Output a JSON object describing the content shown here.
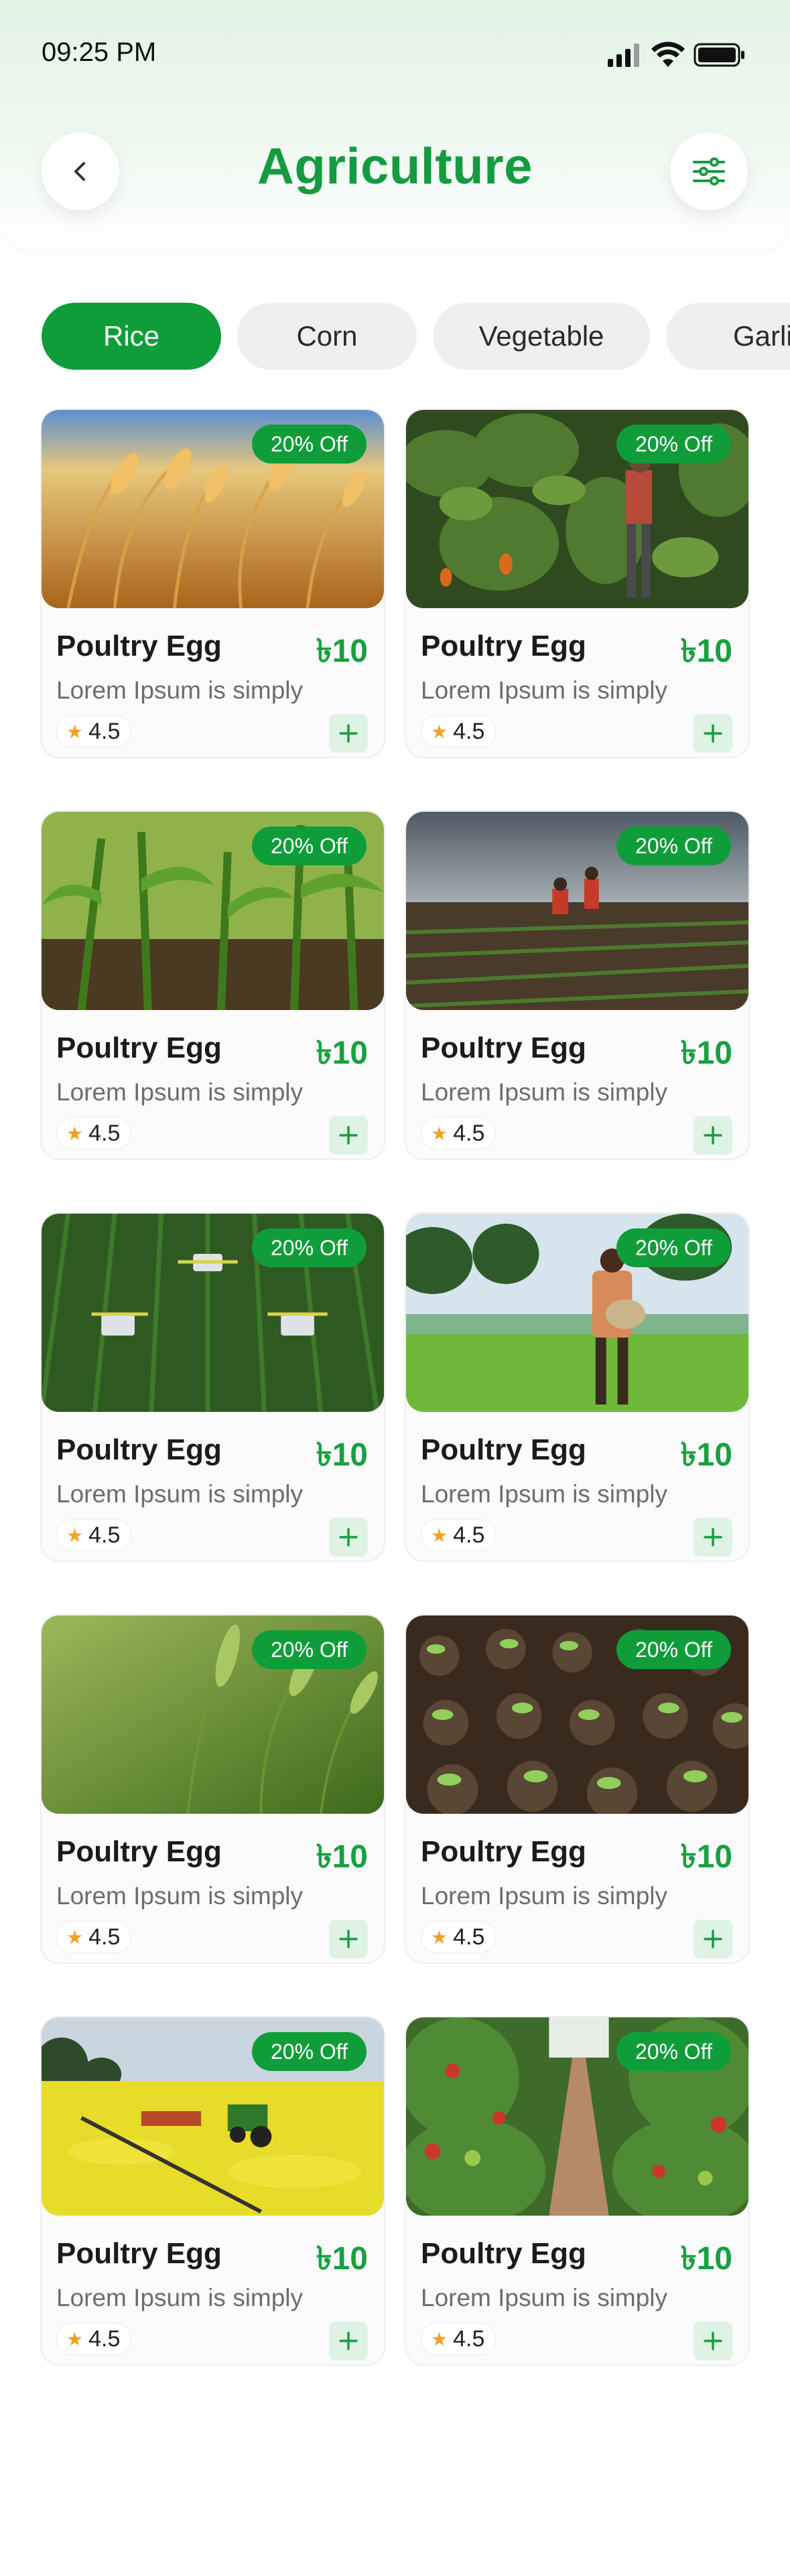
{
  "status_bar": {
    "time": "09:25 PM"
  },
  "header": {
    "title": "Agriculture"
  },
  "categories": [
    {
      "label": "Rice",
      "active": true
    },
    {
      "label": "Corn",
      "active": false
    },
    {
      "label": "Vegetable",
      "active": false
    },
    {
      "label": "Garlic",
      "active": false
    }
  ],
  "products": [
    {
      "title": "Poultry Egg",
      "price": "৳10",
      "description": "Lorem Ipsum is simply",
      "rating": "4.5",
      "badge": "20% Off",
      "image": "wheat-field"
    },
    {
      "title": "Poultry Egg",
      "price": "৳10",
      "description": "Lorem Ipsum is simply",
      "rating": "4.5",
      "badge": "20% Off",
      "image": "pepper-farmer"
    },
    {
      "title": "Poultry Egg",
      "price": "৳10",
      "description": "Lorem Ipsum is simply",
      "rating": "4.5",
      "badge": "20% Off",
      "image": "corn-rows"
    },
    {
      "title": "Poultry Egg",
      "price": "৳10",
      "description": "Lorem Ipsum is simply",
      "rating": "4.5",
      "badge": "20% Off",
      "image": "farmers-field"
    },
    {
      "title": "Poultry Egg",
      "price": "৳10",
      "description": "Lorem Ipsum is simply",
      "rating": "4.5",
      "badge": "20% Off",
      "image": "tractors-aerial"
    },
    {
      "title": "Poultry Egg",
      "price": "৳10",
      "description": "Lorem Ipsum is simply",
      "rating": "4.5",
      "badge": "20% Off",
      "image": "paddy-farmer"
    },
    {
      "title": "Poultry Egg",
      "price": "৳10",
      "description": "Lorem Ipsum is simply",
      "rating": "4.5",
      "badge": "20% Off",
      "image": "green-wheat"
    },
    {
      "title": "Poultry Egg",
      "price": "৳10",
      "description": "Lorem Ipsum is simply",
      "rating": "4.5",
      "badge": "20% Off",
      "image": "seedling-trays"
    },
    {
      "title": "Poultry Egg",
      "price": "৳10",
      "description": "Lorem Ipsum is simply",
      "rating": "4.5",
      "badge": "20% Off",
      "image": "canola-sprayer"
    },
    {
      "title": "Poultry Egg",
      "price": "৳10",
      "description": "Lorem Ipsum is simply",
      "rating": "4.5",
      "badge": "20% Off",
      "image": "tomato-greenhouse"
    }
  ],
  "colors": {
    "accent": "#0f9d3a",
    "price": "#18a03f",
    "star": "#f0a126",
    "add_bg": "#dff3e5"
  },
  "icons": {
    "back": "chevron-left-icon",
    "filter": "sliders-icon",
    "star": "star-icon",
    "add": "plus-icon"
  }
}
